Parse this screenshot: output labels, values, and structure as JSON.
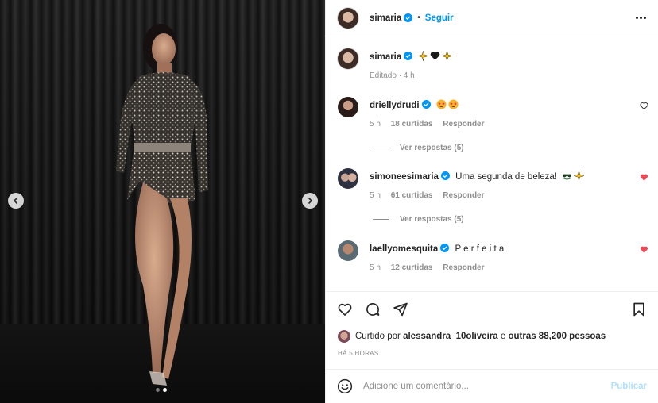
{
  "post": {
    "author": "simaria",
    "follow_label": "Seguir",
    "separator": "•",
    "caption_emojis": [
      "sparkles-icon",
      "black-heart-icon",
      "sparkles-icon"
    ],
    "caption_meta": "Editado · 4 h"
  },
  "carousel": {
    "total": 2,
    "active": 2
  },
  "comments": [
    {
      "user": "driellydrudi",
      "verified": true,
      "emojis": [
        "star-struck-icon",
        "star-struck-icon"
      ],
      "text": "",
      "time": "5 h",
      "likes": "18 curtidas",
      "reply_label": "Responder",
      "liked": false,
      "view_replies": "Ver respostas (5)"
    },
    {
      "user": "simoneesimaria",
      "verified": true,
      "text": "Uma segunda de beleza!",
      "emojis_after": [
        "sunglasses-icon",
        "sparkles-icon"
      ],
      "time": "5 h",
      "likes": "61 curtidas",
      "reply_label": "Responder",
      "liked": true,
      "view_replies": "Ver respostas (5)"
    },
    {
      "user": "laellyomesquita",
      "verified": true,
      "text": "P e r f e i t a",
      "time": "5 h",
      "likes": "12 curtidas",
      "reply_label": "Responder",
      "liked": true
    }
  ],
  "likes_summary": {
    "prefix": "Curtido por",
    "user": "alessandra_10oliveira",
    "middle": "e",
    "others": "outras 88,200 pessoas"
  },
  "time_ago": "HÁ 5 HORAS",
  "composer": {
    "placeholder": "Adicione um comentário...",
    "publish_label": "Publicar"
  },
  "colors": {
    "accent": "#0095f6",
    "like_red": "#ed4956",
    "muted": "#8e8e8e",
    "publish_disabled": "#b2dffc"
  }
}
